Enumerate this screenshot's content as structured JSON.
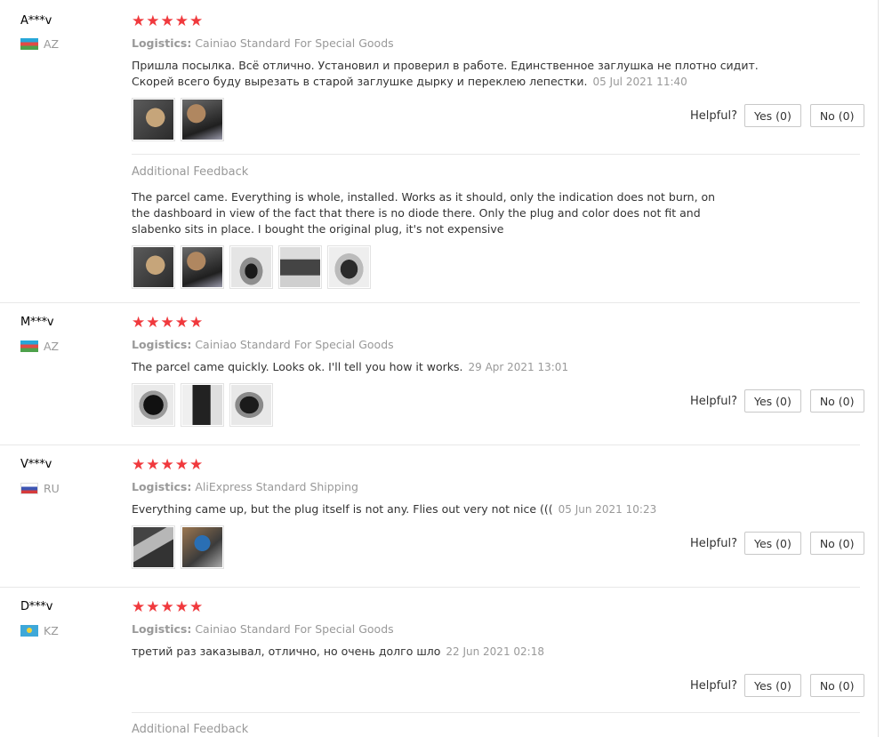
{
  "reviews": [
    {
      "user": "A***v",
      "country": "AZ",
      "flag": "az",
      "stars": 5,
      "logistics_label": "Logistics:",
      "logistics_value": "Cainiao Standard For Special Goods",
      "text": "Пришла посылка. Всё отлично. Установил и проверил в работе. Единственное заглушка не плотно сидит. Скорей всего буду вырезать в старой заглушке дырку и переклею лепестки.",
      "date": "05 Jul 2021 11:40",
      "helpful_label": "Helpful?",
      "yes_label": "Yes (0)",
      "no_label": "No (0)",
      "additional_title": "Additional Feedback",
      "additional_text": "The parcel came. Everything is whole, installed. Works as it should, only the indication does not burn, on the dashboard in view of the fact that there is no diode there. Only the plug and color does not fit and slabenko sits in place. I bought the original plug, it's not expensive"
    },
    {
      "user": "M***v",
      "country": "AZ",
      "flag": "az",
      "stars": 5,
      "logistics_label": "Logistics:",
      "logistics_value": "Cainiao Standard For Special Goods",
      "text": "The parcel came quickly. Looks ok. I'll tell you how it works.",
      "date": "29 Apr 2021 13:01",
      "helpful_label": "Helpful?",
      "yes_label": "Yes (0)",
      "no_label": "No (0)"
    },
    {
      "user": "V***v",
      "country": "RU",
      "flag": "ru",
      "stars": 5,
      "logistics_label": "Logistics:",
      "logistics_value": "AliExpress Standard Shipping",
      "text": "Everything came up, but the plug itself is not any. Flies out very not nice (((",
      "date": "05 Jun 2021 10:23",
      "helpful_label": "Helpful?",
      "yes_label": "Yes (0)",
      "no_label": "No (0)"
    },
    {
      "user": "D***v",
      "country": "KZ",
      "flag": "kz",
      "stars": 5,
      "logistics_label": "Logistics:",
      "logistics_value": "Cainiao Standard For Special Goods",
      "text": "третий раз заказывал, отлично, но очень долго шло",
      "date": "22 Jun 2021 02:18",
      "helpful_label": "Helpful?",
      "yes_label": "Yes (0)",
      "no_label": "No (0)",
      "additional_title": "Additional Feedback"
    }
  ],
  "star_glyph": "★",
  "star_color": "#f0393d"
}
